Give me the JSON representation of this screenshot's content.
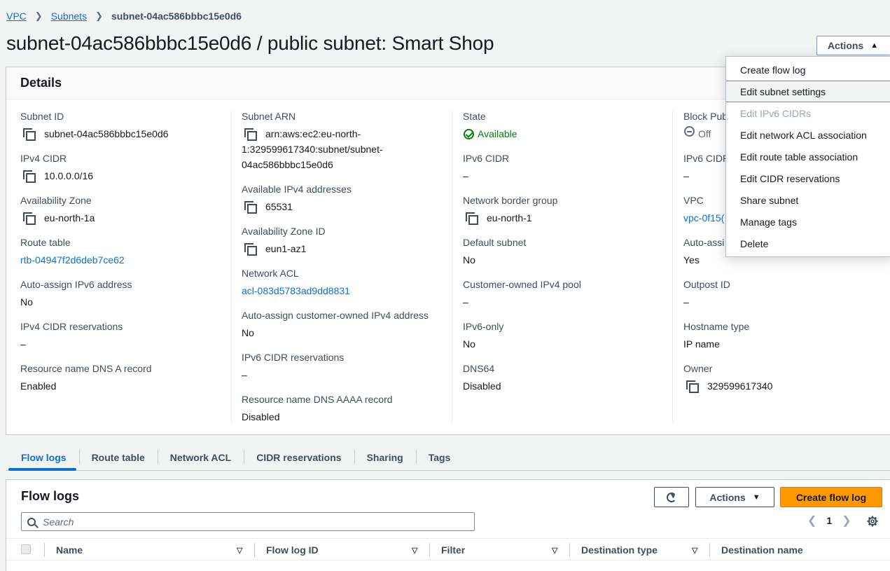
{
  "breadcrumb": {
    "items": [
      "VPC",
      "Subnets"
    ],
    "current": "subnet-04ac586bbbc15e0d6"
  },
  "page_title": "subnet-04ac586bbbc15e0d6 / public subnet: Smart Shop",
  "actions_label": "Actions",
  "details_title": "Details",
  "col1": {
    "subnet_id_label": "Subnet ID",
    "subnet_id": "subnet-04ac586bbbc15e0d6",
    "ipv4_cidr_label": "IPv4 CIDR",
    "ipv4_cidr": "10.0.0.0/16",
    "az_label": "Availability Zone",
    "az": "eu-north-1a",
    "route_table_label": "Route table",
    "route_table": "rtb-04947f2d6deb7ce62",
    "auto_ipv6_label": "Auto-assign IPv6 address",
    "auto_ipv6": "No",
    "ipv4_res_label": "IPv4 CIDR reservations",
    "ipv4_res": "–",
    "dns_a_label": "Resource name DNS A record",
    "dns_a": "Enabled"
  },
  "col2": {
    "arn_label": "Subnet ARN",
    "arn_line1": "arn:aws:ec2:eu-north-",
    "arn_line2": "1:329599617340:subnet/subnet-",
    "arn_line3": "04ac586bbbc15e0d6",
    "avail_ipv4_label": "Available IPv4 addresses",
    "avail_ipv4": "65531",
    "az_id_label": "Availability Zone ID",
    "az_id": "eun1-az1",
    "acl_label": "Network ACL",
    "acl": "acl-083d5783ad9dd8831",
    "auto_cust_label": "Auto-assign customer-owned IPv4 address",
    "auto_cust": "No",
    "ipv6_res_label": "IPv6 CIDR reservations",
    "ipv6_res": "–",
    "dns_aaaa_label": "Resource name DNS AAAA record",
    "dns_aaaa": "Disabled"
  },
  "col3": {
    "state_label": "State",
    "state": "Available",
    "ipv6_cidr_label": "IPv6 CIDR",
    "ipv6_cidr": "–",
    "nbg_label": "Network border group",
    "nbg": "eu-north-1",
    "default_label": "Default subnet",
    "default": "No",
    "cust_pool_label": "Customer-owned IPv4 pool",
    "cust_pool": "–",
    "ipv6_only_label": "IPv6-only",
    "ipv6_only": "No",
    "dns64_label": "DNS64",
    "dns64": "Disabled"
  },
  "col4": {
    "block_label": "Block Pub",
    "block": "Off",
    "ipv6_cidr_label": "IPv6 CIDR",
    "ipv6_cidr": "–",
    "vpc_label": "VPC",
    "vpc": "vpc-0f15(",
    "auto_label": "Auto-assi",
    "auto": "Yes",
    "outpost_label": "Outpost ID",
    "outpost": "–",
    "hostname_label": "Hostname type",
    "hostname": "IP name",
    "owner_label": "Owner",
    "owner": "329599617340"
  },
  "menu": {
    "items": [
      "Create flow log",
      "Edit subnet settings",
      "Edit IPv6 CIDRs",
      "Edit network ACL association",
      "Edit route table association",
      "Edit CIDR reservations",
      "Share subnet",
      "Manage tags",
      "Delete"
    ]
  },
  "tabs": [
    "Flow logs",
    "Route table",
    "Network ACL",
    "CIDR reservations",
    "Sharing",
    "Tags"
  ],
  "flow": {
    "title": "Flow logs",
    "actions": "Actions",
    "create": "Create flow log",
    "search_placeholder": "Search",
    "page": "1",
    "columns": [
      "Name",
      "Flow log ID",
      "Filter",
      "Destination type",
      "Destination name"
    ]
  }
}
